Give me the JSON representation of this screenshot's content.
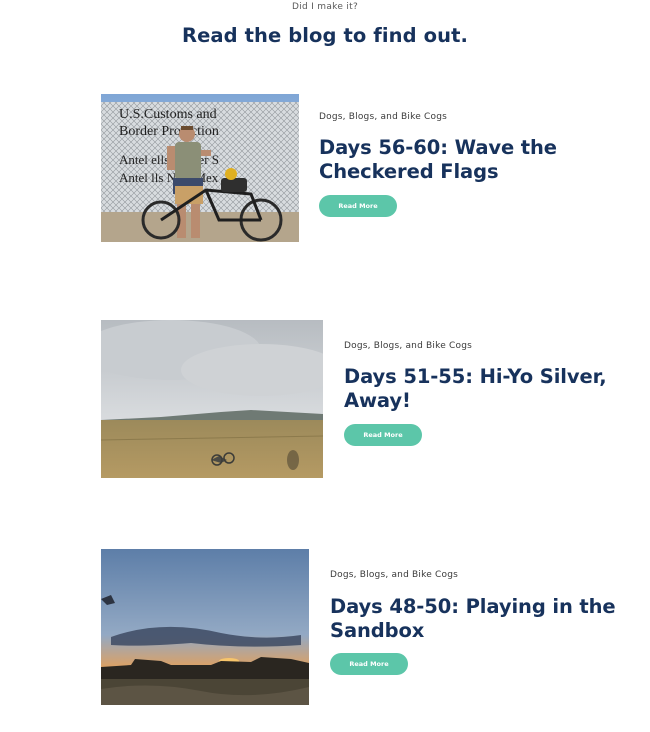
{
  "header": {
    "eyebrow": "Did I make it?",
    "title": "Read the blog to find out."
  },
  "posts": [
    {
      "category": "Dogs, Blogs, and Bike Cogs",
      "title_line1": "Days 56-60: Wave the",
      "title_line2": "Checkered Flags",
      "button_label": "Read More",
      "image": {
        "sign_line1": "U.S.Customs and",
        "sign_line2": "Border Protection",
        "sign_line3": "Antel    ells Border S",
        "sign_line4": "Antel    lls New Mex"
      }
    },
    {
      "category": "Dogs, Blogs, and Bike Cogs",
      "title_line1": "Days 51-55: Hi-Yo Silver,",
      "title_line2": "Away!",
      "button_label": "Read More"
    },
    {
      "category": "Dogs, Blogs, and Bike Cogs",
      "title_line1": "Days 48-50: Playing in the",
      "title_line2": "Sandbox",
      "button_label": "Read More"
    }
  ],
  "colors": {
    "heading": "#17325c",
    "button": "#5cc6a9",
    "button_text": "#ffffff"
  }
}
